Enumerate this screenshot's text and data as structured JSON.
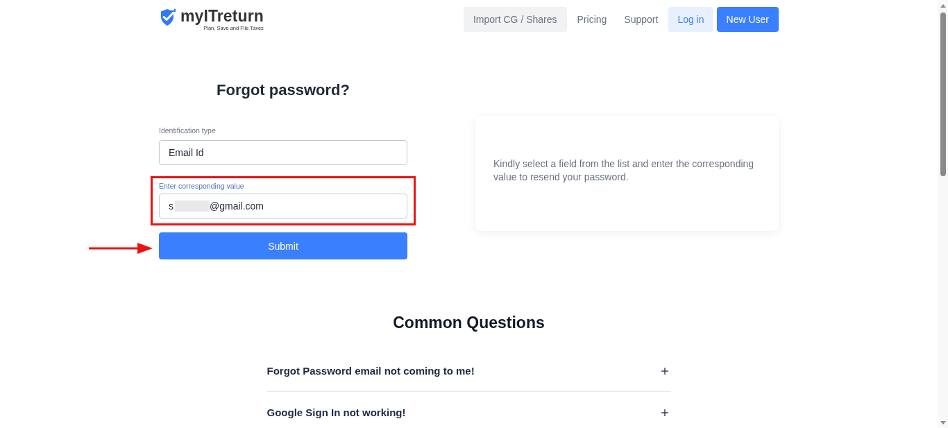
{
  "header": {
    "logo": {
      "name": "myITreturn",
      "tagline": "Plan, Save and File Taxes"
    },
    "nav": [
      {
        "label": "Import CG / Shares",
        "kind": "secondary"
      },
      {
        "label": "Pricing",
        "kind": "link"
      },
      {
        "label": "Support",
        "kind": "link"
      },
      {
        "label": "Log in",
        "kind": "light"
      },
      {
        "label": "New User",
        "kind": "primary"
      }
    ]
  },
  "form": {
    "title": "Forgot password?",
    "fields": [
      {
        "label": "Identification type",
        "value": "Email Id",
        "redacted": false,
        "highlighted": false
      },
      {
        "label": "Enter corresponding value",
        "value": "s",
        "value_after_redaction": "@gmail.com",
        "redacted": true,
        "highlighted": true
      }
    ],
    "submit": {
      "label": "Submit",
      "arrow": true
    }
  },
  "info_card": {
    "text": "Kindly select a field from the list and enter the corresponding value to resend your password."
  },
  "faq": {
    "title": "Common Questions",
    "items": [
      {
        "question": "Forgot Password email not coming to me!",
        "expanded": false
      },
      {
        "question": "Google Sign In not working!",
        "expanded": false
      }
    ]
  }
}
